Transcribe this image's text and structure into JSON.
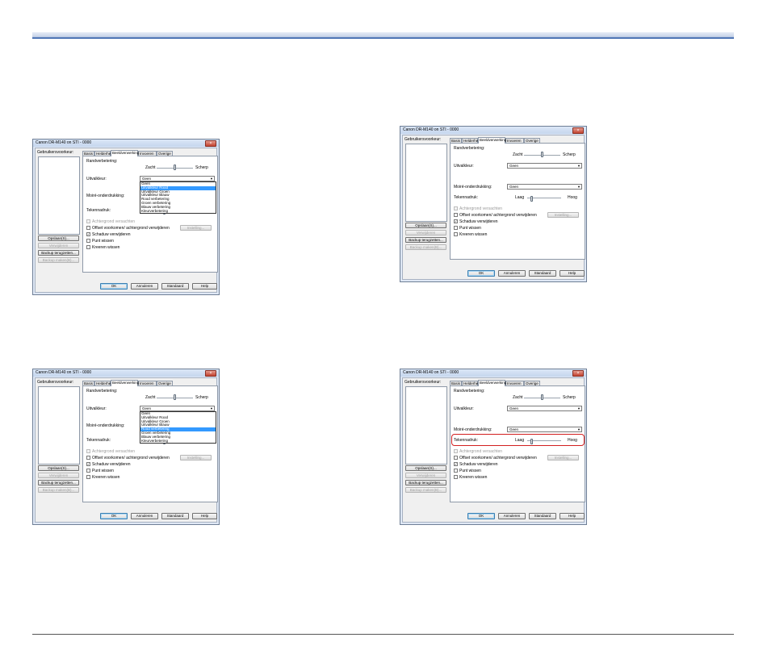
{
  "dialog": {
    "title": "Canon DR-M140 on STI - 0000",
    "close_glyph": "×",
    "favorites_label": "Gebruikersvoorkeur:",
    "favorites_buttons": [
      "Opslaan(S)...",
      "Verwijderen",
      "Backup terugzetten...",
      "Backup maken(B)..."
    ],
    "tabs": [
      "Basis",
      "Helderheid",
      "Beeldverwerking",
      "Invoeren",
      "Overige"
    ],
    "active_tab": "Beeldverwerking",
    "edge_label": "Randverbetering:",
    "edge_soft": "Zacht",
    "edge_sharp": "Scherp",
    "dropout_label": "Uitvalkleur:",
    "dropout_value": "Geen",
    "moire_label": "Moiré-onderdrukking:",
    "moire_value": "Geen",
    "char_label": "Tekennadruk:",
    "char_low": "Laag",
    "char_high": "Hoog",
    "background_smoothing": "Achtergrond versachten",
    "offset_label": "Offset voorkomen/ achtergrond verwijderen",
    "settings_button": "Instelling...",
    "shadow_label": "Schaduw verwijderen",
    "dot_label": "Punt wissen",
    "notch_label": "Kreeren wissen",
    "bottom_buttons": {
      "ok": "OK",
      "cancel": "Annuleren",
      "default": "Standaard",
      "help": "Help"
    },
    "dropdown_options": [
      "Geen",
      "Uitvalkleur Rood",
      "Uitvalkleur Groen",
      "Uitvalkleur Blauw",
      "Rood verbetering",
      "Groen verbetering",
      "Blauw verbetering",
      "Kleurverbetering"
    ]
  },
  "screens": [
    {
      "id": "top-left",
      "dropdown_open": true,
      "selected_option": "Uitvalkleur Rood"
    },
    {
      "id": "top-right",
      "dropdown_open": false
    },
    {
      "id": "bottom-left",
      "dropdown_open": true,
      "selected_option": "Rood verbetering"
    },
    {
      "id": "bottom-right",
      "dropdown_open": false,
      "highlighted": "Tekennadruk"
    }
  ],
  "colors": {
    "accent_rule": "#2f5da8",
    "dialog_bg": "#dfe8f5",
    "close_button": "#c2422f",
    "selection": "#3399ff",
    "callout_border": "#d21f1f"
  }
}
